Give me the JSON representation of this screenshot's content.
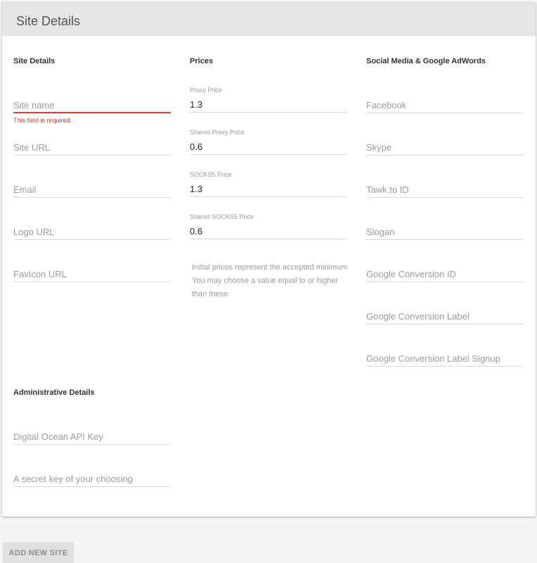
{
  "header": {
    "title": "Site Details"
  },
  "sections": {
    "site_details": "Site Details",
    "prices": "Prices",
    "social": "Social Media & Google AdWords",
    "admin": "Administrative Details"
  },
  "site_fields": {
    "site_name": {
      "placeholder": "Site name",
      "error": "This field is required."
    },
    "site_url": {
      "placeholder": "Site URL"
    },
    "email": {
      "placeholder": "Email"
    },
    "logo_url": {
      "placeholder": "Logo URL"
    },
    "favicon_url": {
      "placeholder": "FavIcon URL"
    }
  },
  "price_fields": {
    "proxy": {
      "label": "Proxy Price",
      "value": "1.3"
    },
    "shared_proxy": {
      "label": "Shared Proxy Price",
      "value": "0.6"
    },
    "socks5": {
      "label": "SOCKS5 Price",
      "value": "1.3"
    },
    "shared_socks5": {
      "label": "Shared SOCKS5 Price",
      "value": "0.6"
    },
    "note_line1": "Initial prices represent the accepted minimum",
    "note_line2": "You may choose a value equal to or higher than these"
  },
  "social_fields": {
    "facebook": "Facebook",
    "skype": "Skype",
    "tawk": "Tawk.to ID",
    "slogan": "Slogan",
    "conv_id": "Google Conversion ID",
    "conv_label": "Google Conversion Label",
    "conv_label_signup": "Google Conversion Label Signup"
  },
  "admin_fields": {
    "do_api_key": "Digital Ocean API Key",
    "secret_key": "A secret key of your choosing"
  },
  "actions": {
    "add_site": "ADD NEW SITE"
  },
  "colors": {
    "error": "#e53935",
    "header_bg": "#e5e5e5",
    "page_bg": "#f5f5f5"
  }
}
